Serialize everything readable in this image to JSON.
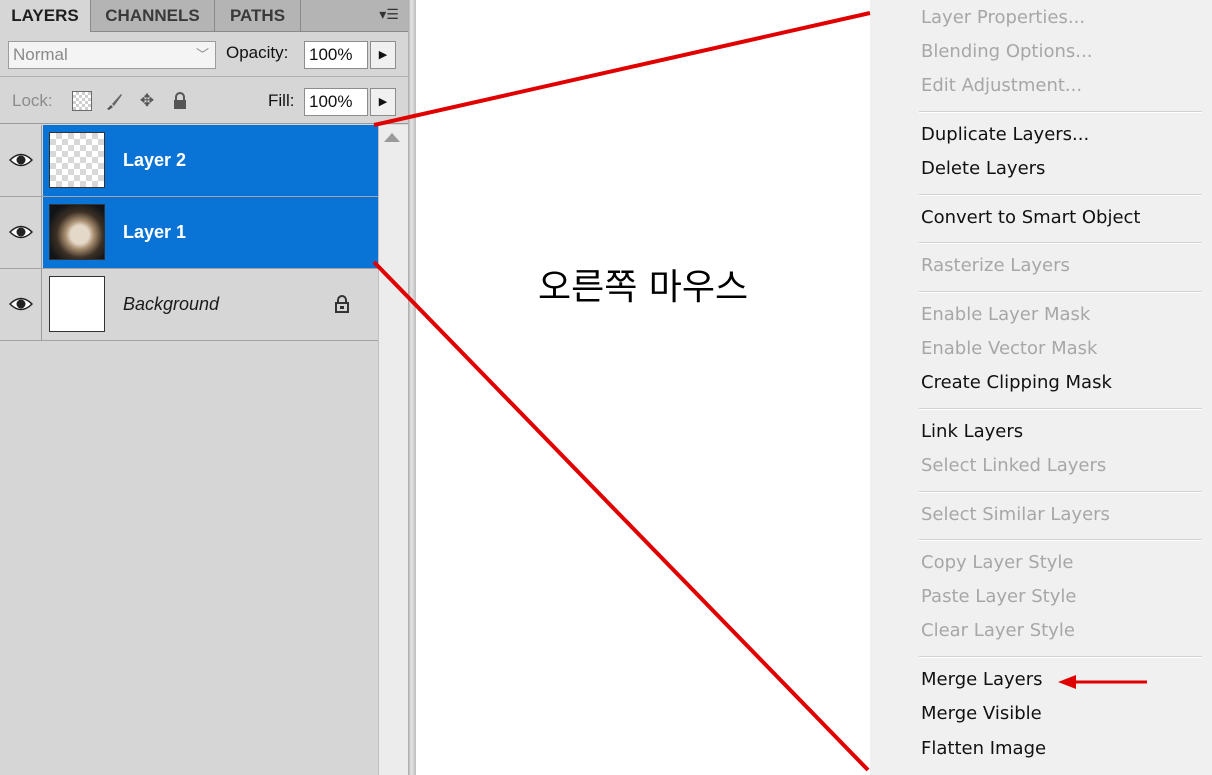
{
  "panel": {
    "tabs": [
      {
        "label": "LAYERS",
        "active": true
      },
      {
        "label": "CHANNELS",
        "active": false
      },
      {
        "label": "PATHS",
        "active": false
      }
    ],
    "menu_icon": "panel-menu-icon",
    "blend_mode": "Normal",
    "opacity_label": "Opacity:",
    "opacity_value": "100%",
    "lock_label": "Lock:",
    "lock_icons": [
      "lock-transparent-icon",
      "lock-brush-icon",
      "lock-move-icon",
      "lock-all-icon"
    ],
    "fill_label": "Fill:",
    "fill_value": "100%",
    "layers": [
      {
        "name": "Layer 2",
        "selected": true,
        "thumbnail": "transparent"
      },
      {
        "name": "Layer 1",
        "selected": true,
        "thumbnail": "photo"
      },
      {
        "name": "Background",
        "selected": false,
        "thumbnail": "white",
        "locked": true
      }
    ]
  },
  "annotation": {
    "text": "오른쪽 마우스",
    "line_color": "#e00000"
  },
  "context_menu": {
    "groups": [
      [
        {
          "label": "Layer Properties...",
          "enabled": false
        },
        {
          "label": "Blending Options...",
          "enabled": false
        },
        {
          "label": "Edit Adjustment...",
          "enabled": false
        }
      ],
      [
        {
          "label": "Duplicate Layers...",
          "enabled": true
        },
        {
          "label": "Delete Layers",
          "enabled": true
        }
      ],
      [
        {
          "label": "Convert to Smart Object",
          "enabled": true
        }
      ],
      [
        {
          "label": "Rasterize Layers",
          "enabled": false
        }
      ],
      [
        {
          "label": "Enable Layer Mask",
          "enabled": false
        },
        {
          "label": "Enable Vector Mask",
          "enabled": false
        },
        {
          "label": "Create Clipping Mask",
          "enabled": true
        }
      ],
      [
        {
          "label": "Link Layers",
          "enabled": true
        },
        {
          "label": "Select Linked Layers",
          "enabled": false
        }
      ],
      [
        {
          "label": "Select Similar Layers",
          "enabled": false
        }
      ],
      [
        {
          "label": "Copy Layer Style",
          "enabled": false
        },
        {
          "label": "Paste Layer Style",
          "enabled": false
        },
        {
          "label": "Clear Layer Style",
          "enabled": false
        }
      ],
      [
        {
          "label": "Merge Layers",
          "enabled": true,
          "highlighted_by_arrow": true
        },
        {
          "label": "Merge Visible",
          "enabled": true
        },
        {
          "label": "Flatten Image",
          "enabled": true
        }
      ]
    ]
  },
  "colors": {
    "selection": "#0a74d6",
    "panel_bg": "#d6d6d6",
    "menu_bg": "#f0f0f0",
    "disabled_text": "#a7a7a7",
    "annotation_red": "#e00000"
  }
}
